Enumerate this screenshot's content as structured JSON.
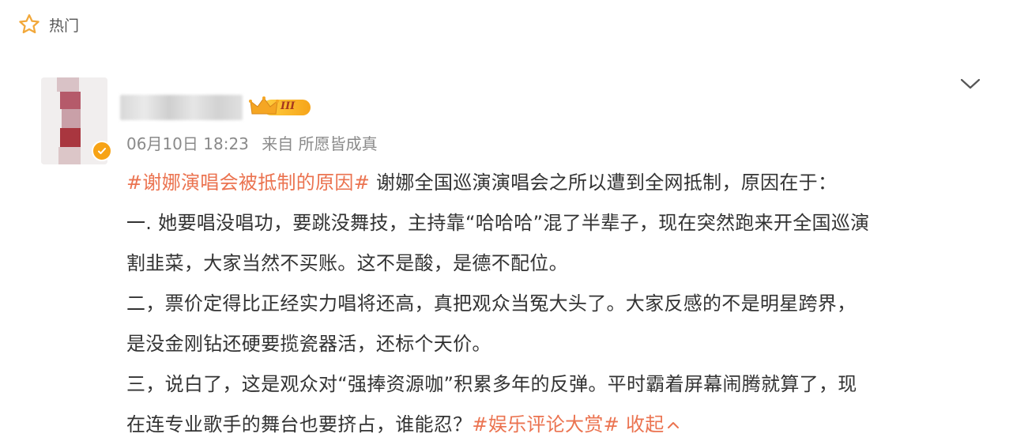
{
  "section": {
    "label": "热门",
    "icon": "star-icon"
  },
  "post": {
    "time": "06月10日 18:23",
    "source": "来自 所愿皆成真",
    "member_level": "III",
    "hashtag_topic": "#谢娜演唱会被抵制的原因#",
    "intro": " 谢娜全国巡演演唱会之所以遭到全网抵制，原因在于：",
    "line1a": "一. 她要唱没唱功，要跳没舞技，主持靠“哈哈哈”混了半辈子，现在突然跑来开全国巡演",
    "line1b": "割韭菜，大家当然不买账。这不是酸，是德不配位。",
    "line2a": "二，票价定得比正经实力唱将还高，真把观众当冤大头了。大家反感的不是明星跨界，",
    "line2b": "是没金刚钻还硬要揽瓷器活，还标个天价。",
    "line3a": "三，说白了，这是观众对“强捧资源咖”积累多年的反弹。平时霸着屏幕闹腾就算了，现",
    "line3b": "在连专业歌手的舞台也要挤占，谁能忍？",
    "hashtag_end": "#娱乐评论大赏#",
    "collapse_label": "收起"
  },
  "colors": {
    "accent": "#eb7350",
    "meta": "#8a8a8a",
    "text": "#333333",
    "star": "#f2a83a"
  }
}
